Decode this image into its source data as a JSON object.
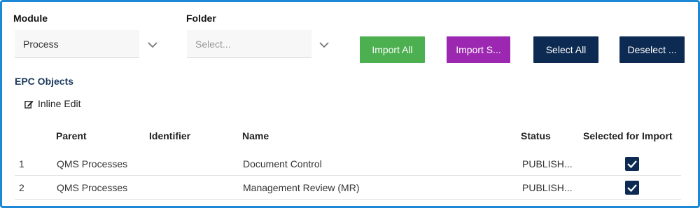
{
  "filters": {
    "module": {
      "label": "Module",
      "value": "Process"
    },
    "folder": {
      "label": "Folder",
      "placeholder": "Select..."
    }
  },
  "buttons": {
    "import_all": "Import All",
    "import_selected": "Import S...",
    "select_all": "Select All",
    "deselect": "Deselect ..."
  },
  "colors": {
    "import_all": "#4caf50",
    "import_selected": "#9c27b0",
    "dark": "#0d2b52",
    "frame": "#1e88d4"
  },
  "section": {
    "title": "EPC Objects",
    "inline_edit": "Inline Edit"
  },
  "table": {
    "headers": {
      "parent": "Parent",
      "identifier": "Identifier",
      "name": "Name",
      "status": "Status",
      "selected": "Selected for Import"
    },
    "rows": [
      {
        "index": "1",
        "parent": "QMS Processes",
        "identifier": "",
        "name": "Document Control",
        "status": "PUBLISH...",
        "selected": true
      },
      {
        "index": "2",
        "parent": "QMS Processes",
        "identifier": "",
        "name": "Management Review (MR)",
        "status": "PUBLISH...",
        "selected": true
      }
    ]
  }
}
